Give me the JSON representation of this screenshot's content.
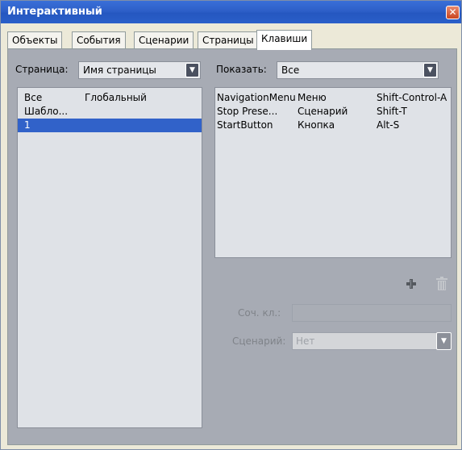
{
  "window": {
    "title": "Интерактивный"
  },
  "tabs": [
    {
      "label": "Объекты"
    },
    {
      "label": "События"
    },
    {
      "label": "Сценарии"
    },
    {
      "label": "Страницы"
    },
    {
      "label": "Клавиши",
      "active": true
    }
  ],
  "left": {
    "page_label": "Страница:",
    "page_select": "Имя страницы",
    "rows": [
      {
        "name": "Все",
        "scope": "Глобальный"
      },
      {
        "name": "Шабло...",
        "scope": ""
      },
      {
        "name": "1",
        "scope": "",
        "selected": true
      }
    ]
  },
  "right": {
    "show_label": "Показать:",
    "show_select": "Все",
    "rows": [
      {
        "name": "NavigationMenu",
        "type": "Меню",
        "key": "Shift-Control-A"
      },
      {
        "name": "Stop Prese...",
        "type": "Сценарий",
        "key": "Shift-T"
      },
      {
        "name": "StartButton",
        "type": "Кнопка",
        "key": "Alt-S"
      }
    ],
    "shortcut_label": "Соч. кл.:",
    "shortcut_value": "",
    "scenario_label": "Сценарий:",
    "scenario_value": "Нет"
  },
  "icons": {
    "add": "plus-icon",
    "delete": "trash-icon",
    "close": "close-icon",
    "dropdown": "chevron-down-icon"
  },
  "colors": {
    "titlebar": "#2d5fc8",
    "panel": "#a7abb4",
    "selection": "#3162c9",
    "list_bg": "#dfe2e7"
  }
}
